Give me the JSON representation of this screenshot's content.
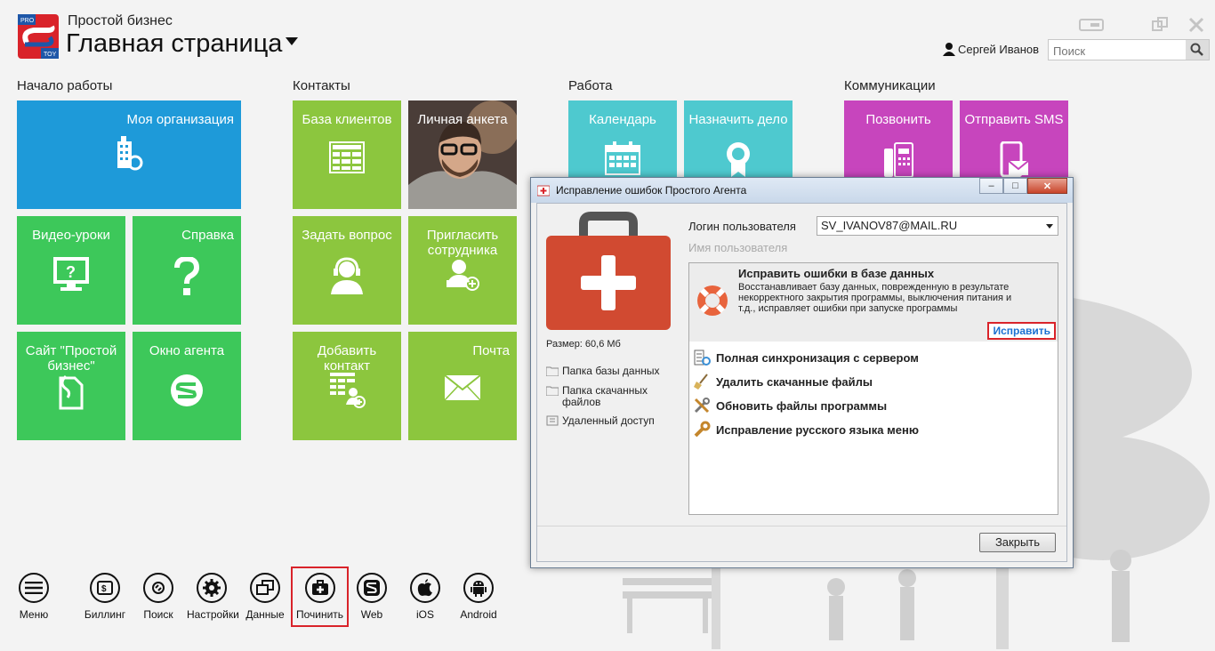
{
  "header": {
    "app_subtitle": "Простой бизнес",
    "page_title": "Главная страница",
    "logo_text_top": "PRO",
    "logo_text_bottom": "TOY",
    "user_name": "Сергей Иванов",
    "search_placeholder": "Поиск"
  },
  "sections": {
    "start": "Начало работы",
    "contacts": "Контакты",
    "work": "Работа",
    "comm": "Коммуникации"
  },
  "tiles": {
    "my_org": "Моя организация",
    "video": "Видео-уроки",
    "help": "Справка",
    "site": "Сайт \"Простой бизнес\"",
    "agent": "Окно агента",
    "clients": "База клиентов",
    "profile": "Личная анкета",
    "ask": "Задать вопрос",
    "invite": "Пригласить сотрудника",
    "add_contact": "Добавить контакт",
    "mail": "Почта",
    "calendar": "Календарь",
    "assign": "Назначить дело",
    "call": "Позвонить",
    "sms": "Отправить SMS"
  },
  "toolbar": {
    "menu": "Меню",
    "billing": "Биллинг",
    "search": "Поиск",
    "settings": "Настройки",
    "data": "Данные",
    "repair": "Починить",
    "web": "Web",
    "ios": "iOS",
    "android": "Android"
  },
  "dialog": {
    "title": "Исправление ошибок Простого Агента",
    "size": "Размер: 60,6 Мб",
    "side_links": [
      "Папка базы данных",
      "Папка скачанных файлов",
      "Удаленный доступ"
    ],
    "login_label": "Логин пользователя",
    "login_value": "SV_IVANOV87@MAIL.RU",
    "username_placeholder": "Имя пользователя",
    "fix_db_title": "Исправить ошибки в базе данных",
    "fix_db_desc": "Восстанавливает базу данных, поврежденную в результате некорректного закрытия программы, выключения питания и т.д., исправляет ошибки при запуске программы",
    "fix_button": "Исправить",
    "options": [
      "Полная синхронизация с сервером",
      "Удалить скачанные файлы",
      "Обновить файлы программы",
      "Исправление русского языка меню"
    ],
    "close_button": "Закрыть"
  },
  "colors": {
    "blue": "#1e9ad9",
    "green": "#3dc85a",
    "lime": "#8cc63e",
    "teal": "#4ec9cf",
    "magenta": "#c745bd",
    "highlight": "#d9232a"
  }
}
